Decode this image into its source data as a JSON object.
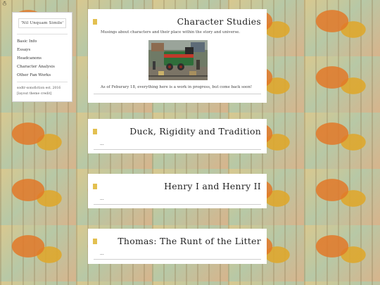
{
  "corner_icon": "accessibility-icon",
  "sidebar": {
    "blog_title": "'Nil Unquam Simile'",
    "nav": [
      {
        "label": "Basic Info"
      },
      {
        "label": "Essays"
      },
      {
        "label": "Headcanons"
      },
      {
        "label": "Character Analysis"
      },
      {
        "label": "Other Fan Works"
      }
    ],
    "footer_line1": "sodtr-sonofiction  est. 2016",
    "footer_line2": "[layout theme credit]"
  },
  "posts": [
    {
      "title": "Character Studies",
      "desc": "Musings about characters and their place within the story and universe.",
      "note": "As of Feburary 18, everything here is a work in progress, but come back soon!"
    },
    {
      "title": "Duck, Rigidity and Tradition",
      "ellipsis": "..."
    },
    {
      "title": "Henry I and Henry II",
      "ellipsis": "..."
    },
    {
      "title": "Thomas: The Runt of the Litter",
      "ellipsis": "..."
    }
  ],
  "colors": {
    "marker": "#e3c050",
    "panel": "#ffffff"
  }
}
